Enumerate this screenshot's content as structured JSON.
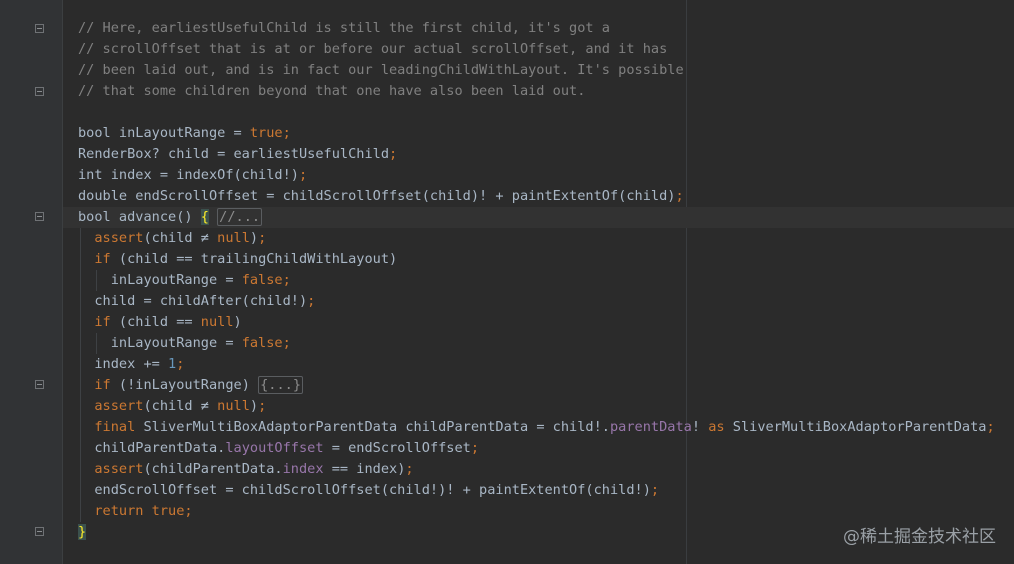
{
  "code": {
    "lines": [
      [
        {
          "t": "// Here, earliestUsefulChild is still the first child, it's got a",
          "c": "cm"
        }
      ],
      [
        {
          "t": "// scrollOffset that is at or before our actual scrollOffset, and it has",
          "c": "cm"
        }
      ],
      [
        {
          "t": "// been laid out, and is in fact our leadingChildWithLayout. It's possible",
          "c": "cm"
        }
      ],
      [
        {
          "t": "// that some children beyond that one have also been laid out.",
          "c": "cm"
        }
      ],
      [],
      [
        {
          "t": "bool inLayoutRange = "
        },
        {
          "t": "true",
          "c": "kw"
        },
        {
          "t": ";",
          "c": "kw"
        }
      ],
      [
        {
          "t": "RenderBox? child = earliestUsefulChild"
        },
        {
          "t": ";",
          "c": "kw"
        }
      ],
      [
        {
          "t": "int index = indexOf(child!)"
        },
        {
          "t": ";",
          "c": "kw"
        }
      ],
      [
        {
          "t": "double endScrollOffset = childScrollOffset(child)! + paintExtentOf(child)"
        },
        {
          "t": ";",
          "c": "kw"
        }
      ],
      [
        {
          "t": "bool advance() "
        },
        {
          "t": "{",
          "c": "brace-hl"
        },
        {
          "t": " "
        },
        {
          "t": "//...",
          "c": "fold-box"
        }
      ],
      [
        {
          "t": "  "
        },
        {
          "t": "assert",
          "c": "kw"
        },
        {
          "t": "(child ≠ "
        },
        {
          "t": "null",
          "c": "kw"
        },
        {
          "t": ")"
        },
        {
          "t": ";",
          "c": "kw"
        }
      ],
      [
        {
          "t": "  "
        },
        {
          "t": "if",
          "c": "kw"
        },
        {
          "t": " (child == trailingChildWithLayout)"
        }
      ],
      [
        {
          "t": "    inLayoutRange = "
        },
        {
          "t": "false",
          "c": "kw"
        },
        {
          "t": ";",
          "c": "kw"
        }
      ],
      [
        {
          "t": "  child = childAfter(child!)"
        },
        {
          "t": ";",
          "c": "kw"
        }
      ],
      [
        {
          "t": "  "
        },
        {
          "t": "if",
          "c": "kw"
        },
        {
          "t": " (child == "
        },
        {
          "t": "null",
          "c": "kw"
        },
        {
          "t": ")"
        }
      ],
      [
        {
          "t": "    inLayoutRange = "
        },
        {
          "t": "false",
          "c": "kw"
        },
        {
          "t": ";",
          "c": "kw"
        }
      ],
      [
        {
          "t": "  index += "
        },
        {
          "t": "1",
          "c": "num"
        },
        {
          "t": ";",
          "c": "kw"
        }
      ],
      [
        {
          "t": "  "
        },
        {
          "t": "if",
          "c": "kw"
        },
        {
          "t": " (!inLayoutRange) "
        },
        {
          "t": "{...}",
          "c": "fold-box"
        }
      ],
      [
        {
          "t": "  "
        },
        {
          "t": "assert",
          "c": "kw"
        },
        {
          "t": "(child ≠ "
        },
        {
          "t": "null",
          "c": "kw"
        },
        {
          "t": ")"
        },
        {
          "t": ";",
          "c": "kw"
        }
      ],
      [
        {
          "t": "  "
        },
        {
          "t": "final",
          "c": "kw"
        },
        {
          "t": " SliverMultiBoxAdaptorParentData childParentData = child!."
        },
        {
          "t": "parentData",
          "c": "fld"
        },
        {
          "t": "! "
        },
        {
          "t": "as",
          "c": "kw"
        },
        {
          "t": " SliverMultiBoxAdaptorParentData"
        },
        {
          "t": ";",
          "c": "kw"
        }
      ],
      [
        {
          "t": "  childParentData."
        },
        {
          "t": "layoutOffset",
          "c": "fld"
        },
        {
          "t": " = endScrollOffset"
        },
        {
          "t": ";",
          "c": "kw"
        }
      ],
      [
        {
          "t": "  "
        },
        {
          "t": "assert",
          "c": "kw"
        },
        {
          "t": "(childParentData."
        },
        {
          "t": "index",
          "c": "fld"
        },
        {
          "t": " == index)"
        },
        {
          "t": ";",
          "c": "kw"
        }
      ],
      [
        {
          "t": "  endScrollOffset = childScrollOffset(child!)! + paintExtentOf(child!)"
        },
        {
          "t": ";",
          "c": "kw"
        }
      ],
      [
        {
          "t": "  "
        },
        {
          "t": "return",
          "c": "kw"
        },
        {
          "t": " "
        },
        {
          "t": "true",
          "c": "kw"
        },
        {
          "t": ";",
          "c": "kw"
        }
      ],
      [
        {
          "t": "}",
          "c": "brace-hl"
        }
      ]
    ]
  },
  "watermark": "@稀土掘金技术社区",
  "colors": {
    "background": "#2b2b2b",
    "comment": "#808080",
    "keyword": "#cc7832",
    "field": "#9876aa",
    "number": "#6897bb",
    "text": "#a9b7c6"
  }
}
